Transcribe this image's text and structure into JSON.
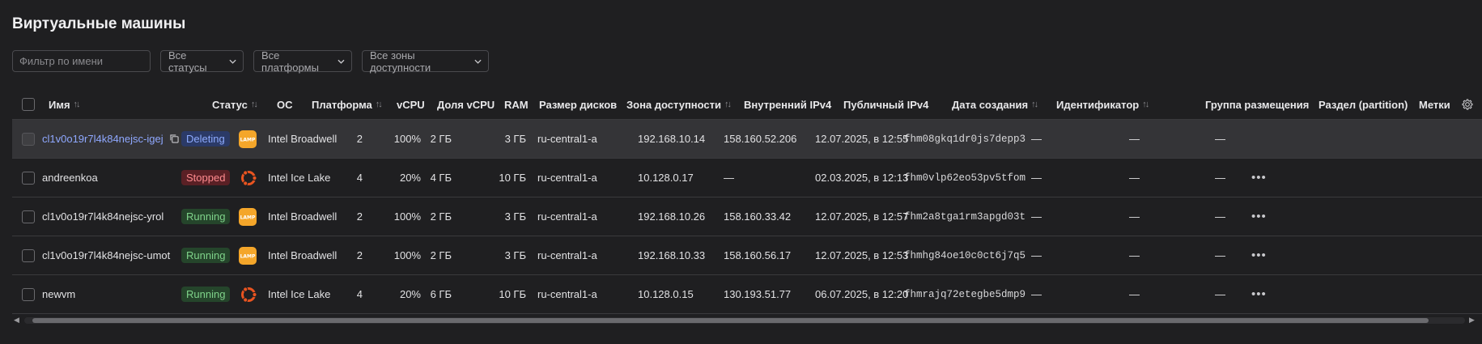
{
  "page": {
    "title": "Виртуальные машины"
  },
  "filters": {
    "name_placeholder": "Фильтр по имени",
    "status": "Все статусы",
    "platform": "Все платформы",
    "zone": "Все зоны доступности"
  },
  "columns": {
    "name": "Имя",
    "status": "Статус",
    "os": "ОС",
    "platform": "Платформа",
    "vcpu": "vCPU",
    "vcpu_share": "Доля vCPU",
    "ram": "RAM",
    "disk": "Размер дисков",
    "zone": "Зона доступности",
    "ip_internal": "Внутренний IPv4",
    "ip_public": "Публичный IPv4",
    "created": "Дата создания",
    "id": "Идентификатор",
    "placement": "Группа размещения",
    "partition": "Раздел (partition)",
    "labels": "Метки"
  },
  "rows": [
    {
      "name": "cl1v0o19r7l4k84nejsc-igej",
      "status": "Deleting",
      "os": "LAMP",
      "platform": "Intel Broadwell",
      "vcpu": "2",
      "vcpu_share": "100%",
      "ram": "2 ГБ",
      "disk": "3 ГБ",
      "zone": "ru-central1-a",
      "ip_internal": "192.168.10.14",
      "ip_public": "158.160.52.206",
      "created": "12.07.2025, в 12:55",
      "id": "fhm08gkq1dr0js7depp3",
      "placement": "—",
      "partition": "—",
      "labels": "—"
    },
    {
      "name": "andreenkoa",
      "status": "Stopped",
      "os": "Ubuntu",
      "platform": "Intel Ice Lake",
      "vcpu": "4",
      "vcpu_share": "20%",
      "ram": "4 ГБ",
      "disk": "10 ГБ",
      "zone": "ru-central1-a",
      "ip_internal": "10.128.0.17",
      "ip_public": "—",
      "created": "02.03.2025, в 12:13",
      "id": "fhm0vlp62eo53pv5tfom",
      "placement": "—",
      "partition": "—",
      "labels": "—"
    },
    {
      "name": "cl1v0o19r7l4k84nejsc-yrol",
      "status": "Running",
      "os": "LAMP",
      "platform": "Intel Broadwell",
      "vcpu": "2",
      "vcpu_share": "100%",
      "ram": "2 ГБ",
      "disk": "3 ГБ",
      "zone": "ru-central1-a",
      "ip_internal": "192.168.10.26",
      "ip_public": "158.160.33.42",
      "created": "12.07.2025, в 12:57",
      "id": "fhm2a8tga1rm3apgd03t",
      "placement": "—",
      "partition": "—",
      "labels": "—"
    },
    {
      "name": "cl1v0o19r7l4k84nejsc-umot",
      "status": "Running",
      "os": "LAMP",
      "platform": "Intel Broadwell",
      "vcpu": "2",
      "vcpu_share": "100%",
      "ram": "2 ГБ",
      "disk": "3 ГБ",
      "zone": "ru-central1-a",
      "ip_internal": "192.168.10.33",
      "ip_public": "158.160.56.17",
      "created": "12.07.2025, в 12:53",
      "id": "fhmhg84oe10c0ct6j7q5",
      "placement": "—",
      "partition": "—",
      "labels": "—"
    },
    {
      "name": "newvm",
      "status": "Running",
      "os": "Ubuntu",
      "platform": "Intel Ice Lake",
      "vcpu": "4",
      "vcpu_share": "20%",
      "ram": "6 ГБ",
      "disk": "10 ГБ",
      "zone": "ru-central1-a",
      "ip_internal": "10.128.0.15",
      "ip_public": "130.193.51.77",
      "created": "06.07.2025, в 12:20",
      "id": "fhmrajq72etegbe5dmp9",
      "placement": "—",
      "partition": "—",
      "labels": "—"
    }
  ],
  "icons": {
    "settings": "gear-icon",
    "row_menu": "more-horizontal-icon",
    "copy": "copy-icon",
    "lamp": "lamp-logo-icon",
    "ubuntu": "ubuntu-logo-icon"
  },
  "colors": {
    "background": "#1f1f21",
    "link": "#8fa8ff",
    "deleting": "#8eabff",
    "stopped": "#ff8b8f",
    "running": "#7fd38a",
    "lamp": "#f4a62a",
    "ubuntu": "#e95420"
  }
}
